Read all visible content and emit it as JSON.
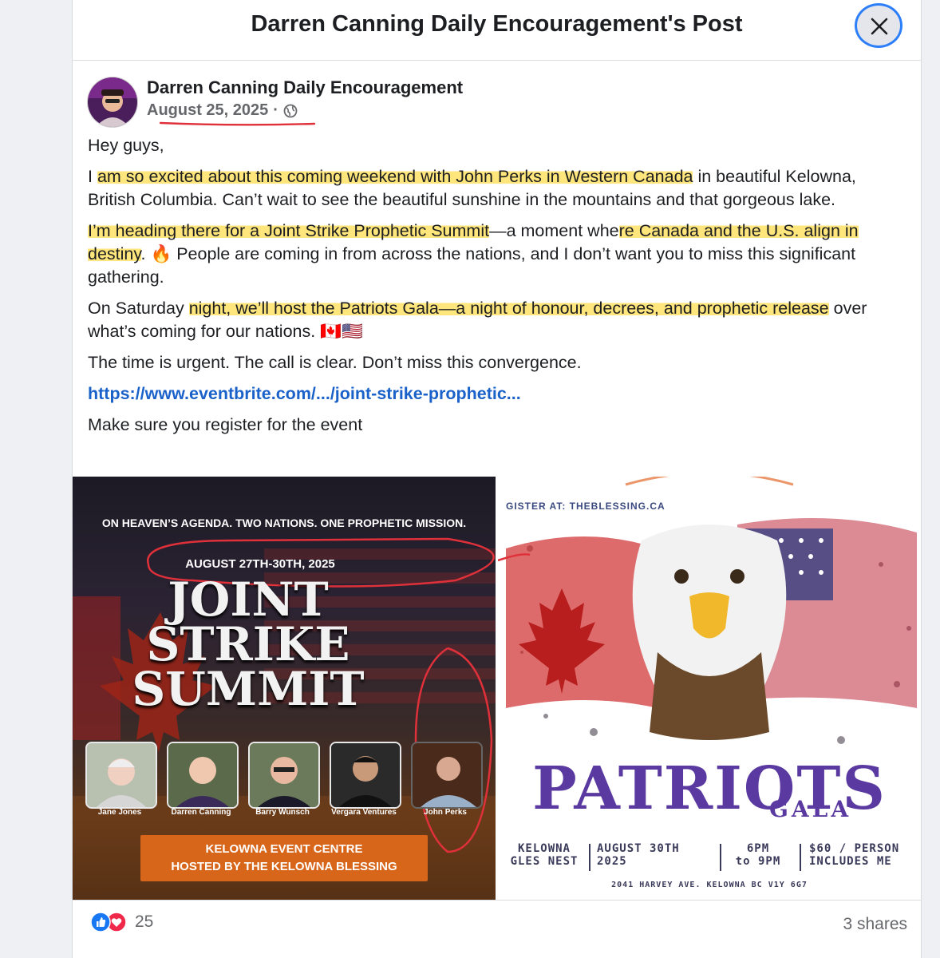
{
  "dialog": {
    "title": "Darren Canning Daily Encouragement's Post"
  },
  "post": {
    "author": "Darren Canning Daily Encouragement",
    "date": "August 25, 2025",
    "separator": "·",
    "privacy_icon": "globe-icon",
    "paragraphs": {
      "p1": "Hey guys,",
      "p2_a": "I ",
      "p2_hl": "am so excited about this coming weekend with John Perks in Western Canada",
      "p2_b": " in beautiful Kelowna, British Columbia.  Can’t wait to see the beautiful sunshine in the mountains and that gorgeous lake.",
      "p3_hl1": "I’m heading there for a Joint Strike Prophetic Summit",
      "p3_a": "—a moment whe",
      "p3_hl2": "re Canada and the U.S. align in destiny",
      "p3_b": ". 🔥 People are coming in from across the nations, and I don’t want you to miss this significant gathering.",
      "p4_a": "On Saturday ",
      "p4_hl": "night, we’ll host the Patriots Gala—a night of honour, decrees, and prophetic release",
      "p4_b": " over what’s coming for our nations. 🇨🇦🇺🇸",
      "p5": "The time is urgent. The call is clear. Don’t miss this convergence.",
      "link": "https://www.eventbrite.com/.../joint-strike-prophetic...",
      "p6": "Make sure you register for the event"
    }
  },
  "poster_left": {
    "tagline": "ON HEAVEN’S AGENDA. TWO NATIONS. ONE PROPHETIC MISSION.",
    "dates": "AUGUST 27TH-30TH, 2025",
    "title_line1": "JOINT",
    "title_line2": "STRIKE",
    "title_line3": "SUMMIT",
    "speakers": [
      "Jane Jones",
      "Darren Canning",
      "Barry Wunsch",
      "Vergara Ventures",
      "John Perks"
    ],
    "venue_line1": "KELOWNA EVENT CENTRE",
    "venue_line2": "HOSTED BY THE KELOWNA BLESSING"
  },
  "poster_right": {
    "register": "GISTER AT: THEBLESSING.CA",
    "title": "PATRIOTS",
    "subtitle": "GALA",
    "col1_line1": "KELOWNA",
    "col1_line2": "GLES NEST",
    "col2_line1": "AUGUST 30TH",
    "col2_line2": "2025",
    "col3_line1": "6PM",
    "col3_line2": "to 9PM",
    "col4_line1": "$60 / PERSON",
    "col4_line2": "INCLUDES ME",
    "address": "2041 HARVEY AVE. KELOWNA BC V1Y 6G7"
  },
  "footer": {
    "reaction_count": "25",
    "shares": "3 shares"
  },
  "colors": {
    "highlight": "#ffde50",
    "link": "#1a62c9",
    "annotation_red": "#e0303a"
  }
}
